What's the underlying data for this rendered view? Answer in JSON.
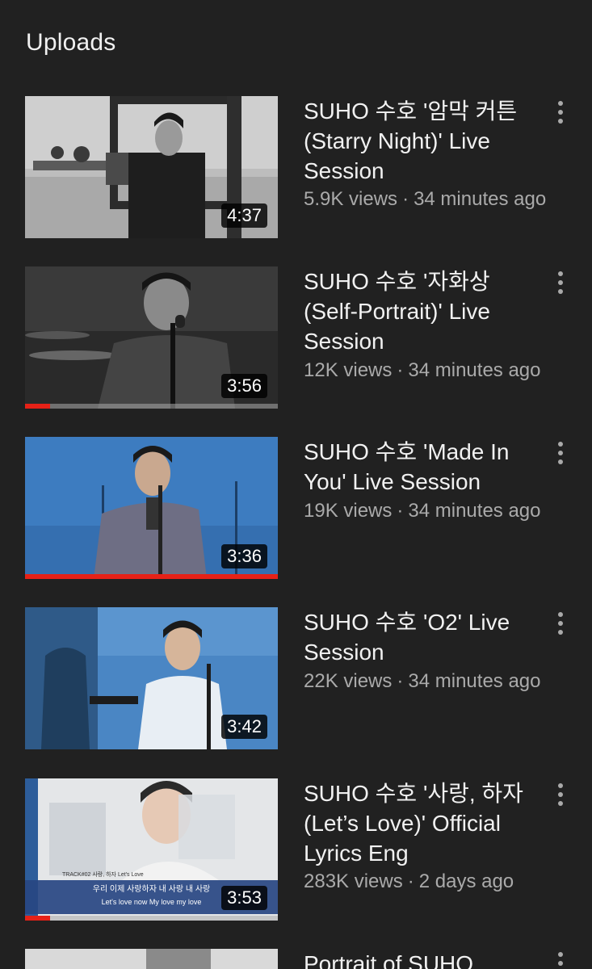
{
  "section": {
    "title": "Uploads"
  },
  "videos": [
    {
      "title": "SUHO 수호 '암막 커튼 (Starry Night)' Live Session",
      "views": "5.9K views",
      "age": "34 minutes ago",
      "duration": "4:37",
      "watched_progress": 0
    },
    {
      "title": "SUHO 수호 '자화상 (Self-Portrait)' Live Session",
      "views": "12K views",
      "age": "34 minutes ago",
      "duration": "3:56",
      "watched_progress": 0.1
    },
    {
      "title": "SUHO 수호 'Made In You' Live Session",
      "views": "19K views",
      "age": "34 minutes ago",
      "duration": "3:36",
      "watched_progress": 1.0
    },
    {
      "title": "SUHO 수호 'O2' Live Session",
      "views": "22K views",
      "age": "34 minutes ago",
      "duration": "3:42",
      "watched_progress": 0
    },
    {
      "title": "SUHO 수호 '사랑, 하자 (Let’s Love)' Official Lyrics Eng",
      "views": "283K views",
      "age": "2 days ago",
      "duration": "3:53",
      "watched_progress": 0.1,
      "thumb_text": {
        "track": "TRACK#02 사랑, 하자 Let's Love",
        "lyric_ko": "우리 이제 사랑하자 내 사랑 내 사랑",
        "lyric_en": "Let's love now My love my love"
      }
    },
    {
      "title": "Portrait of SUHO"
    }
  ],
  "colors": {
    "background": "#212121",
    "title": "#f1f1f1",
    "meta": "#aaaaaa",
    "progress": "#e62117"
  },
  "icons": {
    "menu": "more-vert-icon"
  }
}
